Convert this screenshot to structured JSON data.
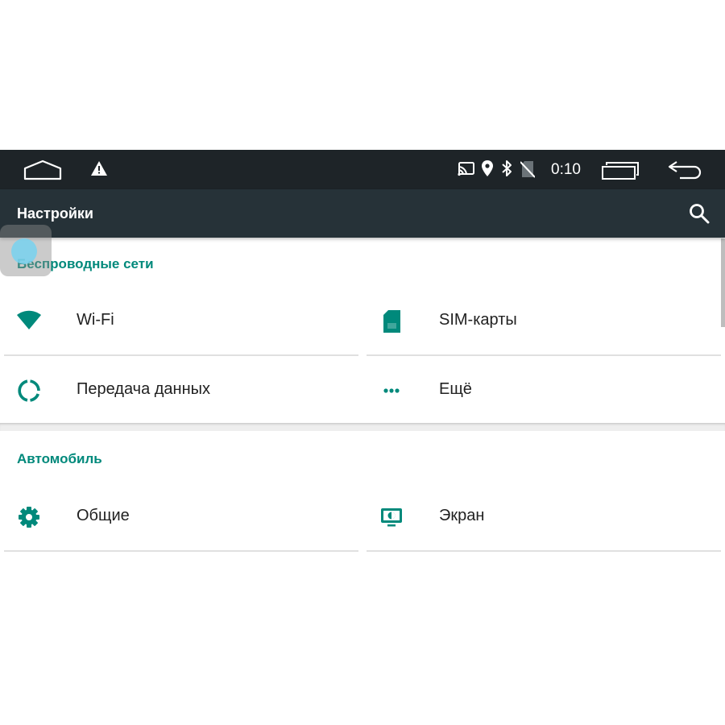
{
  "status_bar": {
    "time": "0:10",
    "left_icons": [
      "home-icon",
      "warning-icon"
    ],
    "right_icons": [
      "cast-icon",
      "location-icon",
      "bluetooth-icon",
      "no-sim-icon",
      "recent-apps-icon",
      "back-icon"
    ]
  },
  "toolbar": {
    "title": "Настройки",
    "search_icon": "search-icon"
  },
  "sections": [
    {
      "header": "Беспроводные сети",
      "tiles": [
        {
          "label": "Wi-Fi",
          "icon": "wifi-icon"
        },
        {
          "label": "SIM-карты",
          "icon": "sim-card-icon"
        },
        {
          "label": "Передача данных",
          "icon": "data-usage-icon"
        },
        {
          "label": "Ещё",
          "icon": "more-icon"
        }
      ]
    },
    {
      "header": "Автомобиль",
      "tiles": [
        {
          "label": "Общие",
          "icon": "settings-icon"
        },
        {
          "label": "Экран",
          "icon": "display-icon"
        }
      ]
    }
  ],
  "colors": {
    "status_bar_bg": "#1e2428",
    "toolbar_bg": "#263238",
    "accent": "#00897b",
    "text": "#212121",
    "divider": "#e0e0e0"
  }
}
